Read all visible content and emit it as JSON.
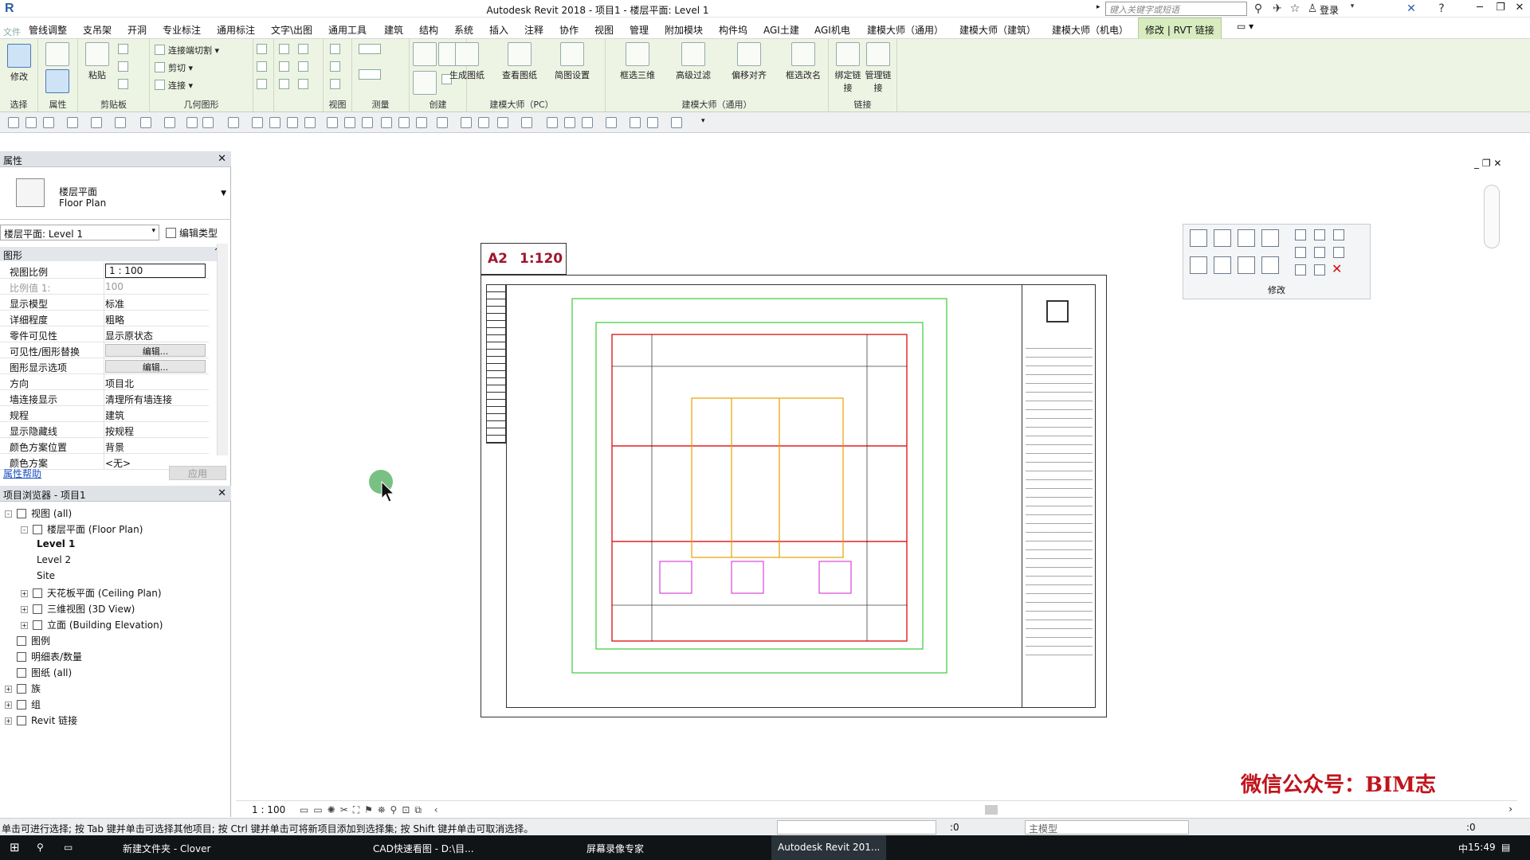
{
  "window": {
    "title": "Autodesk Revit 2018 -    项目1 - 楼层平面: Level 1",
    "search_placeholder": "键入关键字或短语",
    "login": "登录",
    "help": "?"
  },
  "menu": {
    "file": "文件",
    "items": [
      "管线调整",
      "支吊架",
      "开洞",
      "专业标注",
      "通用标注",
      "文字\\出图",
      "通用工具",
      "建筑",
      "结构",
      "系统",
      "插入",
      "注释",
      "协作",
      "视图",
      "管理",
      "附加模块",
      "构件坞",
      "AGI土建",
      "AGI机电",
      "建模大师（通用）",
      "建模大师（建筑）",
      "建模大师（机电）"
    ],
    "active": "修改 | RVT 链接"
  },
  "ribbon": {
    "panels": [
      {
        "label": "选择",
        "buttons": [
          "修改"
        ]
      },
      {
        "label": "属性",
        "buttons": []
      },
      {
        "label": "剪贴板",
        "buttons": [
          "粘贴"
        ]
      },
      {
        "label": "几何图形",
        "buttons": [
          "连接端切割",
          "剪切",
          "连接"
        ]
      },
      {
        "label": "",
        "buttons": []
      },
      {
        "label": "视图",
        "buttons": []
      },
      {
        "label": "测量",
        "buttons": []
      },
      {
        "label": "创建",
        "buttons": []
      },
      {
        "label": "建模大师（PC）",
        "buttons": [
          "生成图纸",
          "查看图纸",
          "简图设置"
        ]
      },
      {
        "label": "建模大师（通用）",
        "buttons": [
          "框选三维",
          "高级过滤",
          "偏移对齐",
          "框选改名"
        ]
      },
      {
        "label": "链接",
        "buttons": [
          "绑定链接",
          "管理链接"
        ]
      }
    ]
  },
  "properties": {
    "title": "属性",
    "type_cn": "楼层平面",
    "type_en": "Floor Plan",
    "instance": "楼层平面: Level 1",
    "edit_type": "编辑类型",
    "section": "图形",
    "rows": [
      {
        "k": "视图比例",
        "v": "1 : 100",
        "kind": "input"
      },
      {
        "k": "比例值 1:",
        "v": "100",
        "kind": "gray"
      },
      {
        "k": "显示模型",
        "v": "标准",
        "kind": "text"
      },
      {
        "k": "详细程度",
        "v": "粗略",
        "kind": "text"
      },
      {
        "k": "零件可见性",
        "v": "显示原状态",
        "kind": "text"
      },
      {
        "k": "可见性/图形替换",
        "v": "编辑...",
        "kind": "button"
      },
      {
        "k": "图形显示选项",
        "v": "编辑...",
        "kind": "button"
      },
      {
        "k": "方向",
        "v": "项目北",
        "kind": "text"
      },
      {
        "k": "墙连接显示",
        "v": "清理所有墙连接",
        "kind": "text"
      },
      {
        "k": "规程",
        "v": "建筑",
        "kind": "text"
      },
      {
        "k": "显示隐藏线",
        "v": "按规程",
        "kind": "text"
      },
      {
        "k": "颜色方案位置",
        "v": "背景",
        "kind": "text"
      },
      {
        "k": "颜色方案",
        "v": "<无>",
        "kind": "text"
      }
    ],
    "help": "属性帮助",
    "apply": "应用"
  },
  "browser": {
    "title": "项目浏览器 - 项目1",
    "items": [
      {
        "t": "视图 (all)",
        "lvl": 0,
        "exp": "-"
      },
      {
        "t": "楼层平面 (Floor Plan)",
        "lvl": 1,
        "exp": "-"
      },
      {
        "t": "Level 1",
        "lvl": 2,
        "exp": "",
        "bold": true
      },
      {
        "t": "Level 2",
        "lvl": 2,
        "exp": ""
      },
      {
        "t": "Site",
        "lvl": 2,
        "exp": ""
      },
      {
        "t": "天花板平面 (Ceiling Plan)",
        "lvl": 1,
        "exp": "+"
      },
      {
        "t": "三维视图 (3D View)",
        "lvl": 1,
        "exp": "+"
      },
      {
        "t": "立面 (Building Elevation)",
        "lvl": 1,
        "exp": "+"
      },
      {
        "t": "图例",
        "lvl": 0,
        "exp": ""
      },
      {
        "t": "明细表/数量",
        "lvl": 0,
        "exp": ""
      },
      {
        "t": "图纸 (all)",
        "lvl": 0,
        "exp": ""
      },
      {
        "t": "族",
        "lvl": 0,
        "exp": "+"
      },
      {
        "t": "组",
        "lvl": 0,
        "exp": "+"
      },
      {
        "t": "Revit 链接",
        "lvl": 0,
        "exp": "+"
      }
    ]
  },
  "canvas": {
    "sheet_size": "A2",
    "sheet_scale": "1:120",
    "modify_panel_label": "修改",
    "watermark": "微信公众号：BIM志"
  },
  "viewbar": {
    "scale": "1 : 100"
  },
  "status": {
    "message": "单击可进行选择; 按 Tab 键并单击可选择其他项目; 按 Ctrl 键并单击可将新项目添加到选择集; 按 Shift 键并单击可取消选择。",
    "coord": ":0",
    "model": "主模型",
    "filter": ":0"
  },
  "taskbar": {
    "items": [
      "新建文件夹 - Clover",
      "CAD快速看图 - D:\\目...",
      "屏幕录像专家",
      "Autodesk Revit 201..."
    ],
    "ime": "中",
    "time": "15:49"
  }
}
